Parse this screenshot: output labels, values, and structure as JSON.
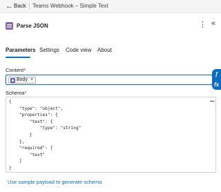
{
  "topbar": {
    "back_label": "Back",
    "flow_title": "Teams Webhook – Simple Text"
  },
  "header": {
    "action_title": "Parse JSON",
    "more_icon": "more-vertical-icon",
    "collapse_icon": "chevron-double-left-icon"
  },
  "tabs": [
    {
      "label": "Parameters",
      "active": true
    },
    {
      "label": "Settings",
      "active": false
    },
    {
      "label": "Code view",
      "active": false
    },
    {
      "label": "About",
      "active": false
    }
  ],
  "content": {
    "label": "Content",
    "required_mark": "*",
    "token_label": "Body",
    "token_close": "×",
    "side_buttons": [
      "ƒ",
      "fx"
    ]
  },
  "schema": {
    "label": "Schema",
    "required_mark": "*",
    "lines": [
      "{",
      "    \"type\": \"object\",",
      "    \"properties\": {",
      "        \"text\": {",
      "            \"type\": \"string\"",
      "        }",
      "    },",
      "    \"required\": [",
      "        \"text\"",
      "    ]",
      "}"
    ]
  },
  "sample_link": "Use sample payload to generate schema",
  "colors": {
    "accent": "#0f6cbd",
    "action_icon": "#8764b8",
    "token_icon": "#5b5fc7"
  }
}
